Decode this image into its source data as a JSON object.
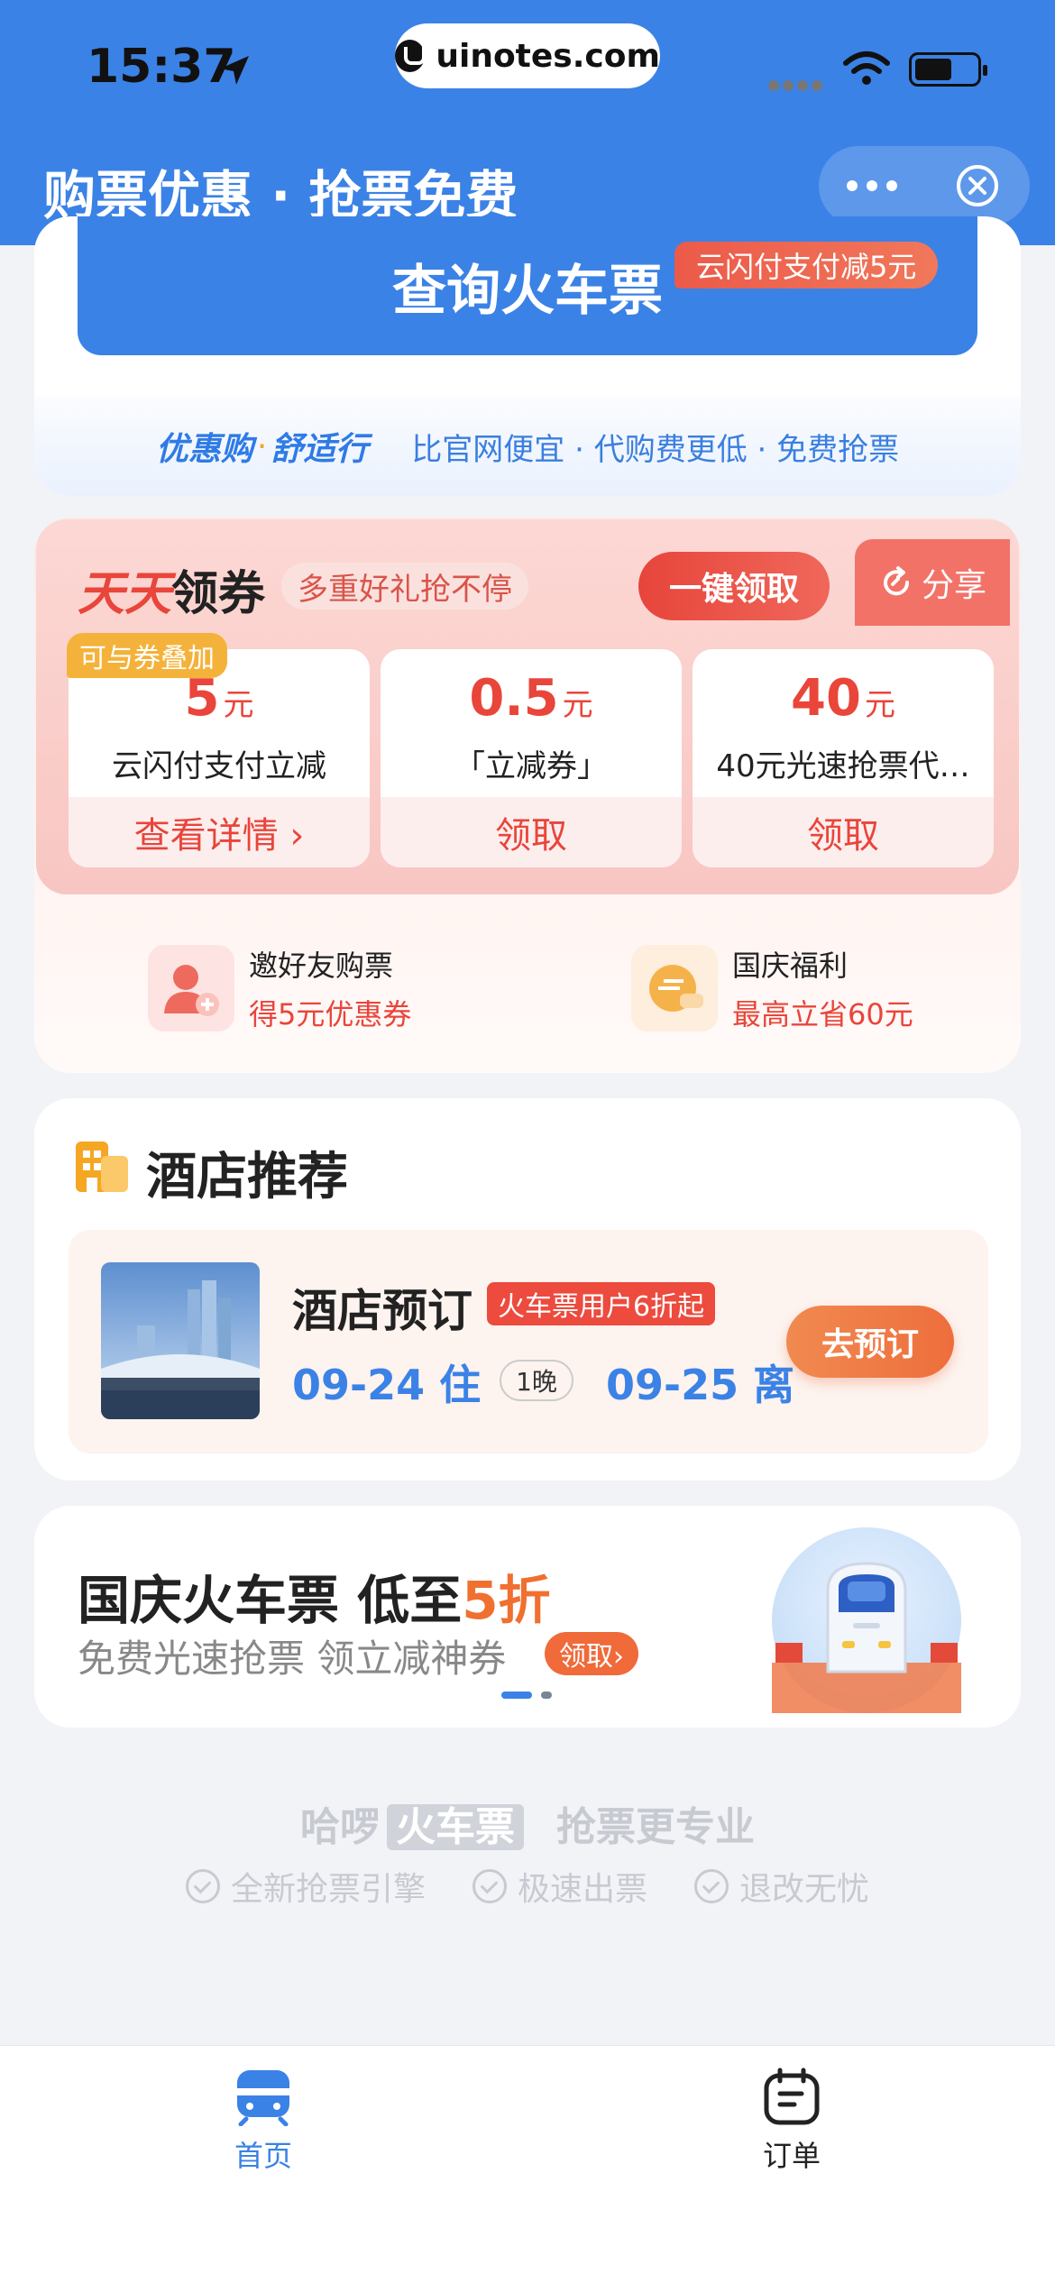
{
  "status_bar": {
    "time": "15:37",
    "url": "uinotes.com"
  },
  "nav": {
    "title": "购票优惠 · 抢票免费"
  },
  "search": {
    "query_button": "查询火车票",
    "query_tag": "云闪付支付减5元",
    "slogan_a": "优惠购",
    "slogan_dot": "·",
    "slogan_b": "舒适行",
    "slogan_right": "比官网便宜 · 代购费更低 · 免费抢票"
  },
  "coupons": {
    "title_red": "天天",
    "title_rest": "领券",
    "subtitle": "多重好礼抢不停",
    "claim_all": "一键领取",
    "share": "分享",
    "stack_tag": "可与券叠加",
    "unit": "元",
    "items": [
      {
        "amount": "5",
        "desc": "云闪付支付立减",
        "action": "查看详情 ›"
      },
      {
        "amount": "0.5",
        "desc": "「立减券」",
        "action": "领取"
      },
      {
        "amount": "40",
        "desc": "40元光速抢票代…",
        "action": "领取"
      }
    ]
  },
  "promos": [
    {
      "title": "邀好友购票",
      "sub": "得5元优惠券"
    },
    {
      "title": "国庆福利",
      "sub": "最高立省60元"
    }
  ],
  "hotel": {
    "section_title": "酒店推荐",
    "name": "酒店预订",
    "tag": "火车票用户6折起",
    "checkin": "09-24 住",
    "nights": "1晚",
    "checkout": "09-25 离",
    "book_button": "去预订"
  },
  "banner": {
    "title_a": "国庆火车票 低至",
    "title_hl": "5折",
    "subtitle": "免费光速抢票 领立减神券",
    "button": "领取›"
  },
  "footer": {
    "brand_a": "哈啰",
    "brand_box": "火车票",
    "brand_b": "抢票更专业",
    "features": [
      "全新抢票引擎",
      "极速出票",
      "退改无忧"
    ]
  },
  "tabs": [
    {
      "label": "首页",
      "active": true
    },
    {
      "label": "订单",
      "active": false
    }
  ],
  "colors": {
    "primary": "#3b82e6",
    "accent_red": "#e9453a",
    "accent_orange": "#f0702f"
  }
}
